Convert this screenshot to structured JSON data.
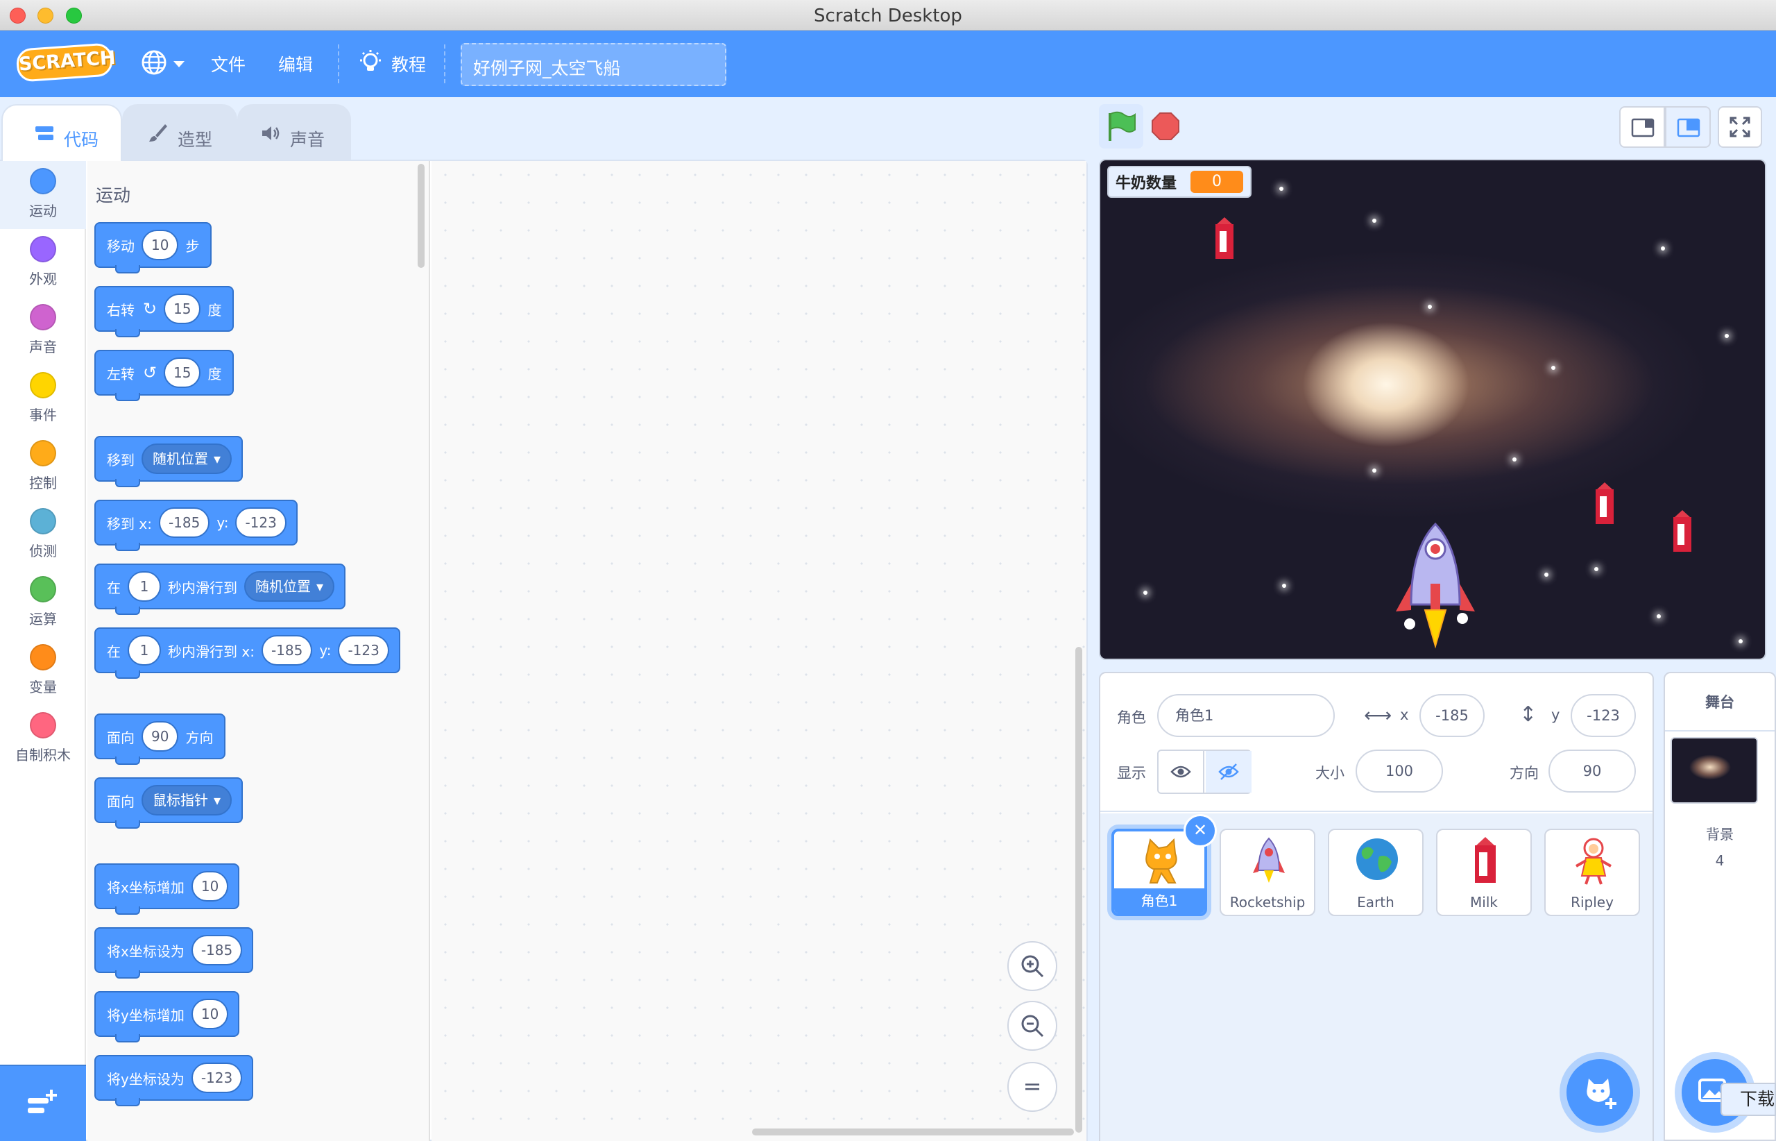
{
  "window": {
    "title": "Scratch Desktop"
  },
  "menubar": {
    "logo": "SCRATCH",
    "file": "文件",
    "edit": "编辑",
    "tutorials": "教程",
    "project_title": "好例子网_太空飞船"
  },
  "tabs": [
    {
      "label": "代码",
      "active": true
    },
    {
      "label": "造型",
      "active": false
    },
    {
      "label": "声音",
      "active": false
    }
  ],
  "categories": [
    {
      "label": "运动",
      "color": "#4c97ff"
    },
    {
      "label": "外观",
      "color": "#9966ff"
    },
    {
      "label": "声音",
      "color": "#cf63cf"
    },
    {
      "label": "事件",
      "color": "#ffd500"
    },
    {
      "label": "控制",
      "color": "#ffab19"
    },
    {
      "label": "侦测",
      "color": "#5cb1d6"
    },
    {
      "label": "运算",
      "color": "#59c059"
    },
    {
      "label": "变量",
      "color": "#ff8c1a"
    },
    {
      "label": "自制积木",
      "color": "#ff6680"
    }
  ],
  "palette": {
    "section_title": "运动",
    "blocks": {
      "move": {
        "a": "移动",
        "v": "10",
        "b": "步"
      },
      "turn_right": {
        "a": "右转",
        "v": "15",
        "b": "度"
      },
      "turn_left": {
        "a": "左转",
        "v": "15",
        "b": "度"
      },
      "goto": {
        "a": "移到",
        "menu": "随机位置"
      },
      "goto_xy": {
        "a": "移到 x:",
        "x": "-185",
        "b": "y:",
        "y": "-123"
      },
      "glide_to": {
        "a": "在",
        "v": "1",
        "b": "秒内滑行到",
        "menu": "随机位置"
      },
      "glide_xy": {
        "a": "在",
        "v": "1",
        "b": "秒内滑行到 x:",
        "x": "-185",
        "c": "y:",
        "y": "-123"
      },
      "point_dir": {
        "a": "面向",
        "v": "90",
        "b": "方向"
      },
      "point_towards": {
        "a": "面向",
        "menu": "鼠标指针"
      },
      "change_x": {
        "a": "将x坐标增加",
        "v": "10"
      },
      "set_x": {
        "a": "将x坐标设为",
        "v": "-185"
      },
      "change_y": {
        "a": "将y坐标增加",
        "v": "10"
      },
      "set_y": {
        "a": "将y坐标设为",
        "v": "-123"
      }
    }
  },
  "zoom": {
    "in": "+",
    "out": "−",
    "reset": "="
  },
  "stage": {
    "monitor": {
      "label": "牛奶数量",
      "value": "0"
    }
  },
  "sprite_info": {
    "sprite_label": "角色",
    "sprite_name": "角色1",
    "x_label": "x",
    "x": "-185",
    "y_label": "y",
    "y": "-123",
    "show_label": "显示",
    "size_label": "大小",
    "size": "100",
    "direction_label": "方向",
    "direction": "90"
  },
  "sprites": [
    {
      "name": "角色1",
      "selected": true
    },
    {
      "name": "Rocketship",
      "selected": false
    },
    {
      "name": "Earth",
      "selected": false
    },
    {
      "name": "Milk",
      "selected": false
    },
    {
      "name": "Ripley",
      "selected": false
    }
  ],
  "stage_target": {
    "title": "舞台",
    "backdrops_label": "背景",
    "backdrops_count": "4"
  },
  "tooltip": {
    "download": "下载"
  },
  "colors": {
    "accent": "#4c97ff",
    "motion": "#4c97ff",
    "variable": "#ff8c1a"
  }
}
